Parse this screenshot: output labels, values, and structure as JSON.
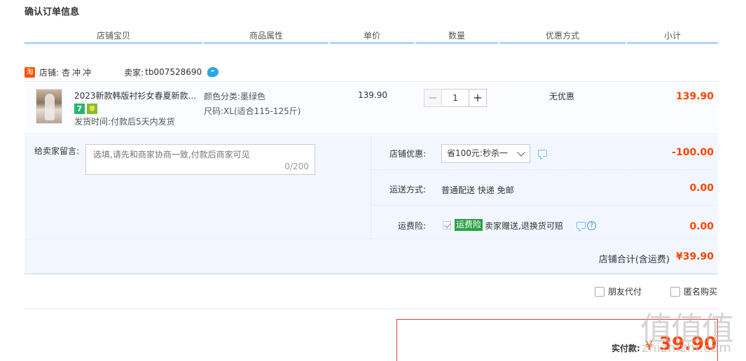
{
  "page": {
    "title": "确认订单信息"
  },
  "columns": [
    "店铺宝贝",
    "商品属性",
    "单价",
    "数量",
    "优惠方式",
    "小计"
  ],
  "shop": {
    "icon_glyph": "淘",
    "shop_label": "店铺:",
    "shop_name": "杏冲冲",
    "seller_label": "卖家:",
    "seller_name": "tb007528690",
    "chat_icon": "wangwang-icon"
  },
  "item": {
    "title": "2023新款韩版衬衫女春夏新款...",
    "badge_seven": "7",
    "ship_time": "发货时间:付款后5天内发货",
    "attr_color": "颜色分类:墨绿色",
    "attr_size": "尺码:XL(适合115-125斤)",
    "unit_price": "139.90",
    "quantity": "1",
    "minus": "−",
    "plus": "+",
    "discount": "无优惠",
    "subtotal": "139.90"
  },
  "message": {
    "label": "给卖家留言:",
    "placeholder": "选填,请先和商家协商一致,付款后商家可见",
    "counter": "0/200"
  },
  "shop_discount": {
    "label": "店铺优惠:",
    "selected": "省100元:秒杀一",
    "value": "-100.00"
  },
  "shipping": {
    "label": "运送方式:",
    "text": "普通配送 快递 免邮",
    "value": "0.00"
  },
  "insurance": {
    "label": "运费险:",
    "tag": "运费险",
    "text": "卖家赠送,退换货可赔",
    "help": "?",
    "value": "0.00"
  },
  "shop_total": {
    "label": "店铺合计(含运费)",
    "value": "¥39.90"
  },
  "options": {
    "friend_pay": "朋友代付",
    "anonymous": "匿名购买"
  },
  "payment": {
    "label": "实付款:",
    "currency": "¥",
    "amount": "39.90"
  },
  "watermark": {
    "glyphs": "值值值",
    "url": "zhizhizhi.com"
  },
  "colors": {
    "price": "#ff4400",
    "header_underline": "#b2d1ff",
    "block_bg": "#f2f7ff",
    "pay_border": "#e4393c"
  }
}
